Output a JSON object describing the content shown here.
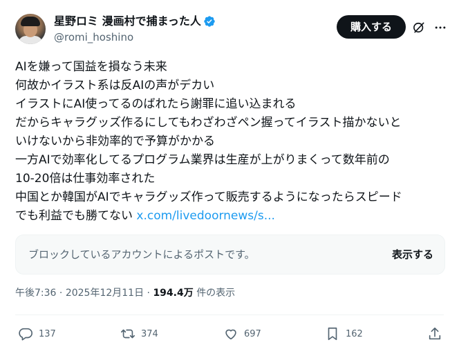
{
  "author": {
    "display_name": "星野ロミ 漫画村で捕まった人",
    "handle": "@romi_hoshino"
  },
  "header": {
    "buy_label": "購入する"
  },
  "tweet": {
    "lines": [
      "AIを嫌って国益を損なう未来",
      "何故かイラスト系は反AIの声がデカい",
      "イラストにAI使ってるのばれたら謝罪に追い込まれる",
      "だからキャラグッズ作るにしてもわざわざペン握ってイラスト描かないと",
      "いけないから非効率的で予算がかかる",
      "一方AIで効率化してるプログラム業界は生産が上がりまくって数年前の",
      "10-20倍は仕事効率された",
      "中国とか韓国がAIでキャラグッズ作って販売するようになったらスピード",
      "でも利益でも勝てない"
    ],
    "link_text": "x.com/livedoornews/s..."
  },
  "blocked": {
    "text": "ブロックしているアカウントによるポストです。",
    "show_label": "表示する"
  },
  "meta": {
    "time": "午後7:36",
    "separator": "·",
    "date": "2025年12月11日",
    "views": "194.4万",
    "views_label": "件の表示"
  },
  "actions": {
    "replies": "137",
    "reposts": "374",
    "likes": "697",
    "bookmarks": "162"
  },
  "colors": {
    "accent": "#1d9bf0",
    "text": "#0f1419",
    "muted": "#536471",
    "button_bg": "#0f1419"
  },
  "icons": [
    "verified-badge-icon",
    "grok-icon",
    "more-icon",
    "reply-icon",
    "repost-icon",
    "like-icon",
    "bookmark-icon",
    "share-icon"
  ]
}
